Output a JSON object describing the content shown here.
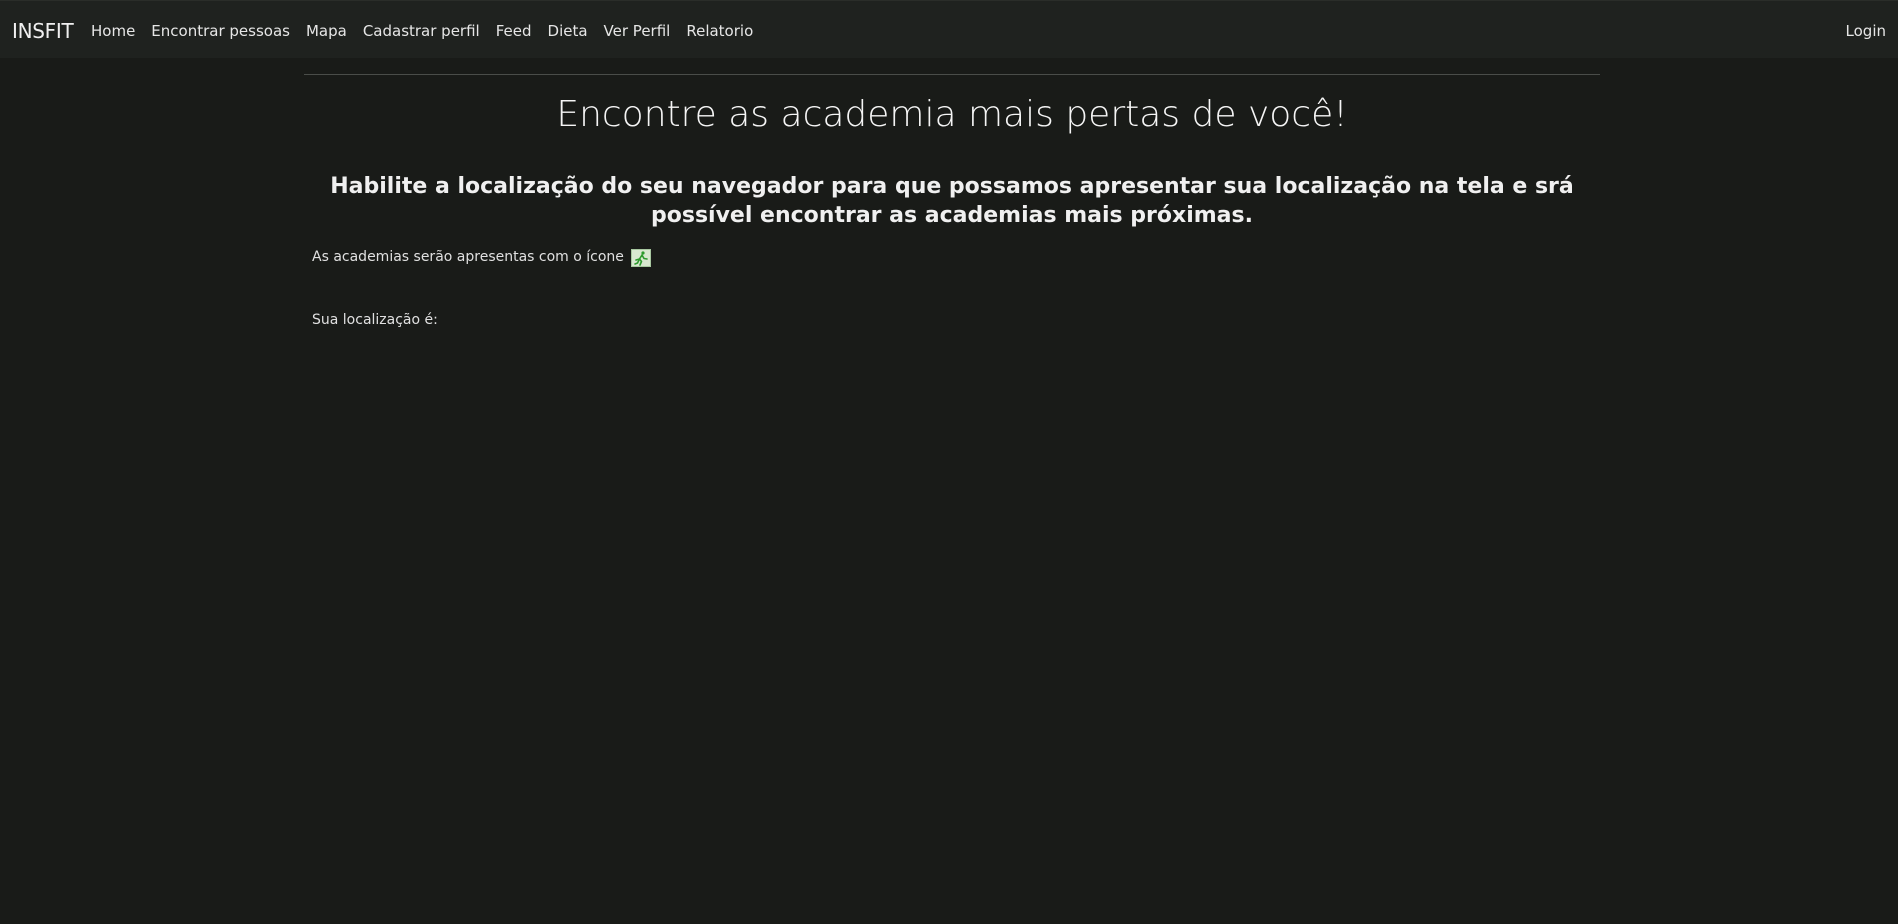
{
  "navbar": {
    "brand": "INSFIT",
    "links": [
      "Home",
      "Encontrar pessoas",
      "Mapa",
      "Cadastrar perfil",
      "Feed",
      "Dieta",
      "Ver Perfil",
      "Relatorio"
    ],
    "login": "Login"
  },
  "main": {
    "title": "Encontre as academia mais pertas de você!",
    "subtitle": "Habilite a localização do seu navegador para que possamos apresentar sua localização na tela e srá possível encontrar as academias mais próximas.",
    "icon_note": "As academias serão apresentas com o ícone",
    "icon_name": "running-person-icon",
    "location_label": "Sua localização é:"
  },
  "colors": {
    "background": "#191b18",
    "navbar": "#1f221f",
    "icon_accent": "#2e9a2e"
  }
}
